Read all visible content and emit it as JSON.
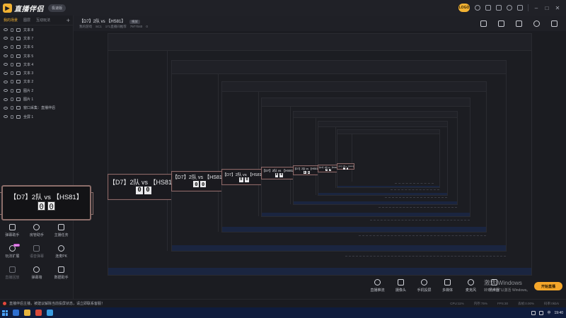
{
  "app": {
    "logo_text": "直播伴侣",
    "version_badge": "极速版",
    "user_badge": "LOGO"
  },
  "layers_panel": {
    "tabs": [
      "我的场景",
      "图层",
      "互动玩法"
    ],
    "active_tab": 0,
    "items": [
      {
        "label": "文本 8",
        "type": "T"
      },
      {
        "label": "文本 7",
        "type": "T"
      },
      {
        "label": "文本 6",
        "type": "T"
      },
      {
        "label": "文本 5",
        "type": "T"
      },
      {
        "label": "文本 4",
        "type": "T"
      },
      {
        "label": "文本 3",
        "type": "T"
      },
      {
        "label": "文本 2",
        "type": "T"
      },
      {
        "label": "图片 2",
        "type": "I"
      },
      {
        "label": "图片 1",
        "type": "I"
      },
      {
        "label": "窗口采集：直播伴侣",
        "type": "W"
      },
      {
        "label": "全屏 1",
        "type": "S"
      }
    ]
  },
  "left_tools": [
    {
      "label": "弹幕助手",
      "dim": false,
      "icon": "monitor-icon"
    },
    {
      "label": "房管助手",
      "dim": false,
      "icon": "user-icon"
    },
    {
      "label": "主播任务",
      "dim": false,
      "icon": "task-icon"
    },
    {
      "label": "玩法扩展",
      "dim": false,
      "icon": "apps-icon",
      "new": "NEW"
    },
    {
      "label": "语音弹幕",
      "dim": true,
      "icon": "mic-icon"
    },
    {
      "label": "连麦PK",
      "dim": false,
      "icon": "pk-icon"
    },
    {
      "label": "直播回放",
      "dim": true,
      "icon": "replay-icon"
    },
    {
      "label": "弹幕墙",
      "dim": false,
      "icon": "wall-icon"
    },
    {
      "label": "数据助手",
      "dim": false,
      "icon": "data-icon"
    }
  ],
  "scene_header": {
    "title": "【D7】2队 vs 【HS81】",
    "badge": "横屏",
    "meta": [
      "我的游戏",
      "SC1",
      "171直播间推荐",
      "7977040",
      "0"
    ]
  },
  "scorecard": {
    "title": "【D7】2队  vs  【HS81】",
    "score_left": "0",
    "score_right": "0"
  },
  "bottom_tools": [
    {
      "label": "直播推流",
      "icon": "stream-icon"
    },
    {
      "label": "摄像头",
      "icon": "camera-icon"
    },
    {
      "label": "手机投屏",
      "icon": "phone-icon"
    },
    {
      "label": "多媒体",
      "icon": "media-icon"
    },
    {
      "label": "麦克风",
      "icon": "mic-icon"
    },
    {
      "label": "扬声器",
      "icon": "speaker-icon"
    }
  ],
  "start_button": "开始直播",
  "windows_watermark": {
    "line1": "激活 Windows",
    "line2": "转到\"设置\"以激活 Windows。"
  },
  "status": {
    "text": "直播伴侣主播，被建议解除当前投屏状态，请立即联系客服！",
    "stats": [
      "CPU:11%",
      "内存:75%",
      "FPS:30",
      "丢帧:0.00%",
      "码率:0kb/s"
    ]
  },
  "taskbar": {
    "time": "19:40",
    "tray_text": "中"
  },
  "colors": {
    "accent": "#f2b233",
    "start_button": "#f4a62a",
    "scorecard_border": "#8c6e6a"
  }
}
